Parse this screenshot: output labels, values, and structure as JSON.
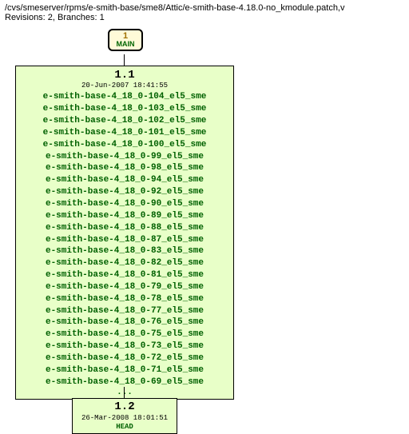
{
  "header": {
    "path": "/cvs/smeserver/rpms/e-smith-base/sme8/Attic/e-smith-base-4.18.0-no_kmodule.patch,v",
    "rev_line": "Revisions: 2, Branches: 1"
  },
  "main_branch": {
    "num": "1",
    "label": "MAIN"
  },
  "rev1": {
    "title": "1.1",
    "date": "20-Jun-2007 18:41:55",
    "tags": [
      "e-smith-base-4_18_0-104_el5_sme",
      "e-smith-base-4_18_0-103_el5_sme",
      "e-smith-base-4_18_0-102_el5_sme",
      "e-smith-base-4_18_0-101_el5_sme",
      "e-smith-base-4_18_0-100_el5_sme",
      "e-smith-base-4_18_0-99_el5_sme",
      "e-smith-base-4_18_0-98_el5_sme",
      "e-smith-base-4_18_0-94_el5_sme",
      "e-smith-base-4_18_0-92_el5_sme",
      "e-smith-base-4_18_0-90_el5_sme",
      "e-smith-base-4_18_0-89_el5_sme",
      "e-smith-base-4_18_0-88_el5_sme",
      "e-smith-base-4_18_0-87_el5_sme",
      "e-smith-base-4_18_0-83_el5_sme",
      "e-smith-base-4_18_0-82_el5_sme",
      "e-smith-base-4_18_0-81_el5_sme",
      "e-smith-base-4_18_0-79_el5_sme",
      "e-smith-base-4_18_0-78_el5_sme",
      "e-smith-base-4_18_0-77_el5_sme",
      "e-smith-base-4_18_0-76_el5_sme",
      "e-smith-base-4_18_0-75_el5_sme",
      "e-smith-base-4_18_0-73_el5_sme",
      "e-smith-base-4_18_0-72_el5_sme",
      "e-smith-base-4_18_0-71_el5_sme",
      "e-smith-base-4_18_0-69_el5_sme"
    ],
    "ellipsis": "..."
  },
  "rev2": {
    "title": "1.2",
    "date": "26-Mar-2008 18:01:51",
    "head": "HEAD"
  }
}
